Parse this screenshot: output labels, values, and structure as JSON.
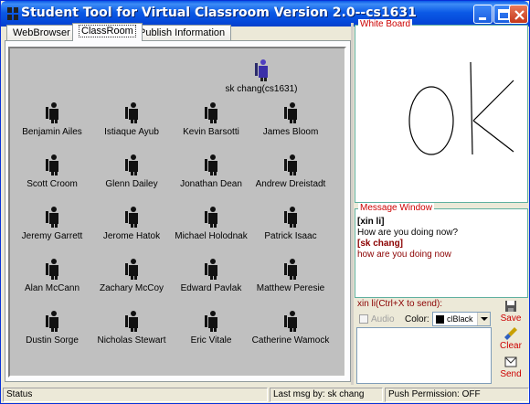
{
  "window": {
    "title": "Student Tool for Virtual Classroom Version 2.0--cs1631"
  },
  "tabs": [
    {
      "label": "WebBrowser"
    },
    {
      "label": "ClassRoom"
    },
    {
      "label": "Publish Information"
    }
  ],
  "classroom": {
    "teacher": "sk chang(cs1631)",
    "students": [
      "Benjamin Ailes",
      "Istiaque Ayub",
      "Kevin Barsotti",
      "James Bloom",
      "Scott Croom",
      "Glenn Dailey",
      "Jonathan Dean",
      "Andrew Dreistadt",
      "Jeremy Garrett",
      "Jerome Hatok",
      "Michael Holodnak",
      "Patrick Isaac",
      "Alan McCann",
      "Zachary McCoy",
      "Edward Pavlak",
      "Matthew Peresie",
      "Dustin Sorge",
      "Nicholas Stewart",
      "Eric Vitale",
      "Catherine Wamock"
    ]
  },
  "whiteboard": {
    "label": "White Board"
  },
  "messages": {
    "label": "Message Window",
    "items": [
      {
        "sender": "[xin li]",
        "text": "How are you doing now?"
      },
      {
        "sender": "[sk chang]",
        "text": " how are you doing now"
      }
    ]
  },
  "compose": {
    "label": "xin li(Ctrl+X to send):",
    "audio_label": "Audio",
    "color_label": "Color:",
    "color_value": "clBlack",
    "save_label": "Save",
    "clear_label": "Clear",
    "send_label": "Send"
  },
  "status": {
    "status": "Status",
    "last_msg": "Last msg by: sk chang",
    "push": "Push Permission: OFF"
  },
  "colors": {
    "title_blue": "#0446d8",
    "accent_red": "#c00000",
    "classroom_bg": "#c0c0c0"
  }
}
